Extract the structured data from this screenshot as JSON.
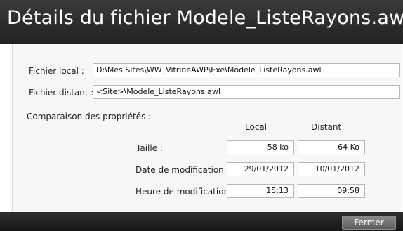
{
  "window": {
    "title": "Détails du fichier Modele_ListeRayons.awl"
  },
  "local_file": {
    "label": "Fichier local :",
    "value": "D:\\Mes Sites\\WW_VitrineAWP\\Exe\\Modele_ListeRayons.awl"
  },
  "remote_file": {
    "label": "Fichier distant :",
    "value": "<Site>\\Modele_ListeRayons.awl"
  },
  "comparison": {
    "heading": "Comparaison des propriétés :",
    "col_local": "Local",
    "col_remote": "Distant",
    "rows": [
      {
        "label": "Taille :",
        "local": "58 ko",
        "remote": "64 Ko"
      },
      {
        "label": "Date de modification :",
        "local": "29/01/2012",
        "remote": "10/01/2012"
      },
      {
        "label": "Heure de modification :",
        "local": "15:13",
        "remote": "09:58"
      }
    ]
  },
  "footer": {
    "close_label": "Fermer"
  }
}
